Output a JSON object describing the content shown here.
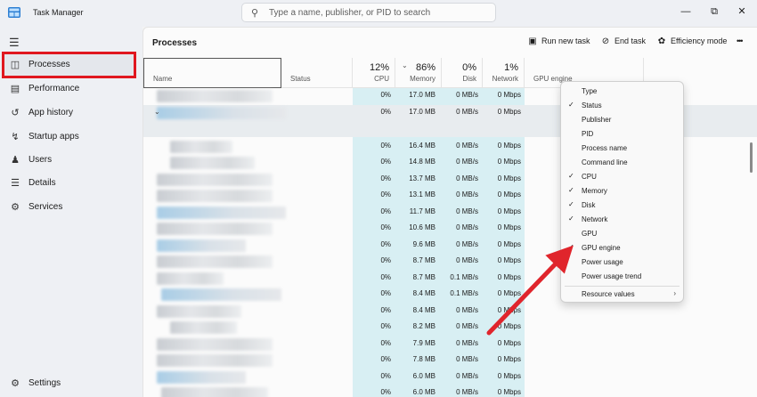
{
  "window": {
    "title": "Task Manager",
    "search_placeholder": "Type a name, publisher, or PID to search",
    "minimize_glyph": "—",
    "maximize_glyph": "⧉",
    "close_glyph": "✕"
  },
  "sidebar": {
    "menu_icon": "hamburger-icon",
    "items": [
      {
        "label": "Processes",
        "icon": "processes-icon",
        "active": true
      },
      {
        "label": "Performance",
        "icon": "performance-icon"
      },
      {
        "label": "App history",
        "icon": "app-history-icon"
      },
      {
        "label": "Startup apps",
        "icon": "startup-icon"
      },
      {
        "label": "Users",
        "icon": "users-icon"
      },
      {
        "label": "Details",
        "icon": "details-icon"
      },
      {
        "label": "Services",
        "icon": "services-icon"
      }
    ],
    "settings_label": "Settings"
  },
  "main": {
    "title": "Processes",
    "toolbar": {
      "run_new_task": "Run new task",
      "end_task": "End task",
      "efficiency_mode": "Efficiency mode",
      "more": "•••"
    }
  },
  "table": {
    "columns": {
      "name": "Name",
      "status": "Status",
      "cpu": {
        "label": "CPU",
        "pct": "12%"
      },
      "memory": {
        "label": "Memory",
        "pct": "86%"
      },
      "disk": {
        "label": "Disk",
        "pct": "0%"
      },
      "network": {
        "label": "Network",
        "pct": "1%"
      },
      "gpu_engine": "GPU engine"
    },
    "rows": [
      {
        "cpu": "0%",
        "mem": "17.0 MB",
        "disk": "0 MB/s",
        "net": "0 Mbps"
      },
      {
        "cpu": "0%",
        "mem": "17.0 MB",
        "disk": "0 MB/s",
        "net": "0 Mbps",
        "expanded": true
      },
      {
        "cpu": "0%",
        "mem": "16.4 MB",
        "disk": "0 MB/s",
        "net": "0 Mbps"
      },
      {
        "cpu": "0%",
        "mem": "14.8 MB",
        "disk": "0 MB/s",
        "net": "0 Mbps"
      },
      {
        "cpu": "0%",
        "mem": "13.7 MB",
        "disk": "0 MB/s",
        "net": "0 Mbps"
      },
      {
        "cpu": "0%",
        "mem": "13.1 MB",
        "disk": "0 MB/s",
        "net": "0 Mbps"
      },
      {
        "cpu": "0%",
        "mem": "11.7 MB",
        "disk": "0 MB/s",
        "net": "0 Mbps"
      },
      {
        "cpu": "0%",
        "mem": "10.6 MB",
        "disk": "0 MB/s",
        "net": "0 Mbps"
      },
      {
        "cpu": "0%",
        "mem": "9.6 MB",
        "disk": "0 MB/s",
        "net": "0 Mbps"
      },
      {
        "cpu": "0%",
        "mem": "8.7 MB",
        "disk": "0 MB/s",
        "net": "0 Mbps"
      },
      {
        "cpu": "0%",
        "mem": "8.7 MB",
        "disk": "0.1 MB/s",
        "net": "0 Mbps"
      },
      {
        "cpu": "0%",
        "mem": "8.4 MB",
        "disk": "0.1 MB/s",
        "net": "0 Mbps"
      },
      {
        "cpu": "0%",
        "mem": "8.4 MB",
        "disk": "0 MB/s",
        "net": "0 Mbps"
      },
      {
        "cpu": "0%",
        "mem": "8.2 MB",
        "disk": "0 MB/s",
        "net": "0 Mbps"
      },
      {
        "cpu": "0%",
        "mem": "7.9 MB",
        "disk": "0 MB/s",
        "net": "0 Mbps"
      },
      {
        "cpu": "0%",
        "mem": "7.8 MB",
        "disk": "0 MB/s",
        "net": "0 Mbps"
      },
      {
        "cpu": "0%",
        "mem": "6.0 MB",
        "disk": "0 MB/s",
        "net": "0 Mbps"
      },
      {
        "cpu": "0%",
        "mem": "6.0 MB",
        "disk": "0 MB/s",
        "net": "0 Mbps"
      }
    ]
  },
  "context_menu": {
    "items": [
      {
        "label": "Type",
        "checked": false
      },
      {
        "label": "Status",
        "checked": true
      },
      {
        "label": "Publisher",
        "checked": false
      },
      {
        "label": "PID",
        "checked": false
      },
      {
        "label": "Process name",
        "checked": false
      },
      {
        "label": "Command line",
        "checked": false
      },
      {
        "label": "CPU",
        "checked": true
      },
      {
        "label": "Memory",
        "checked": true
      },
      {
        "label": "Disk",
        "checked": true
      },
      {
        "label": "Network",
        "checked": true
      },
      {
        "label": "GPU",
        "checked": false
      },
      {
        "label": "GPU engine",
        "checked": true
      },
      {
        "label": "Power usage",
        "checked": false
      },
      {
        "label": "Power usage trend",
        "checked": false
      }
    ],
    "resource_values": "Resource values",
    "check_glyph": "✓",
    "submenu_glyph": "›"
  },
  "annotation": {
    "arrow_color": "#e0252c",
    "highlight_color": "#e0171f"
  }
}
